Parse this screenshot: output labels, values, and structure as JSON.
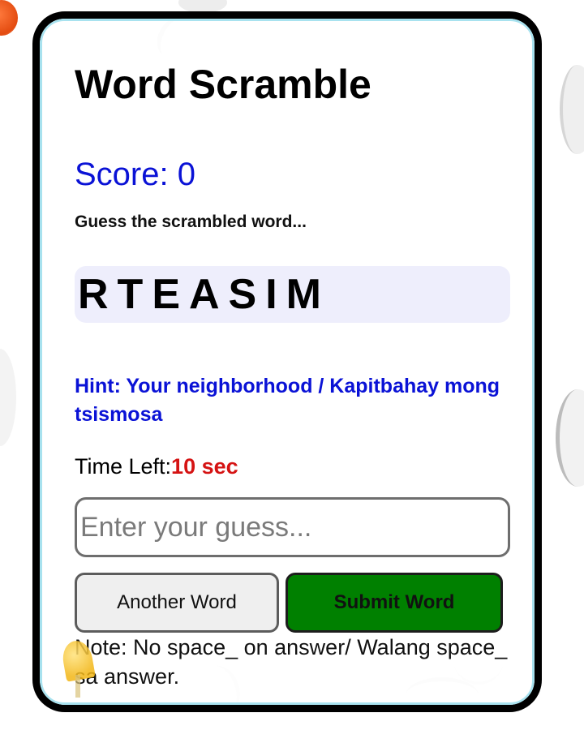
{
  "app": {
    "title": "Word Scramble"
  },
  "score": {
    "label": "Score: 0",
    "value": 0
  },
  "instruction": "Guess the scrambled word...",
  "scrambled_word": "RTEASIM",
  "hint": "Hint: Your neighborhood / Kapitbahay mong tsismosa",
  "timer": {
    "label": "Time Left:",
    "value": "10 sec"
  },
  "guess_input": {
    "value": "",
    "placeholder": "Enter your guess..."
  },
  "buttons": {
    "another_word": "Another Word",
    "submit_word": "Submit Word"
  },
  "note": "Note: No space_ on answer/ Walang space_ sa answer.",
  "colors": {
    "score_text": "#0a12d6",
    "hint_text": "#0a12d6",
    "timer_value": "#d51313",
    "submit_button": "#008000",
    "scramble_box": "#eeeefc",
    "card_border": "#000000"
  }
}
